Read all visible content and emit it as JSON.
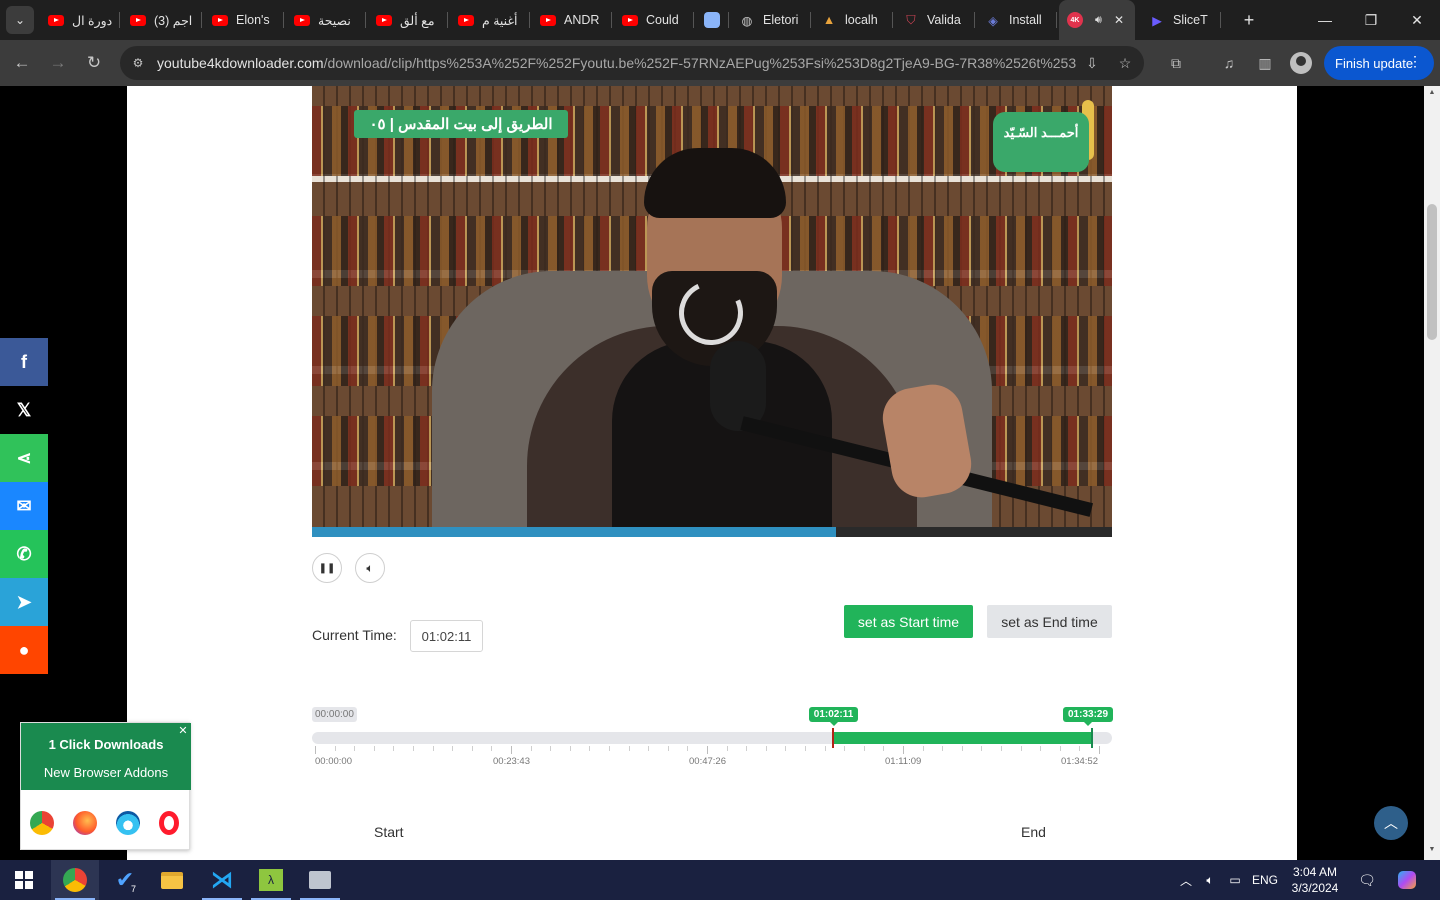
{
  "browser": {
    "tabs": [
      {
        "title": "دورة ال",
        "icon": "youtube-icon"
      },
      {
        "title": "(3) اجم",
        "icon": "youtube-icon"
      },
      {
        "title": "Elon's",
        "icon": "youtube-icon"
      },
      {
        "title": "نصيحة",
        "icon": "youtube-icon"
      },
      {
        "title": "مع ألق",
        "icon": "youtube-icon"
      },
      {
        "title": "أغنية م",
        "icon": "youtube-icon"
      },
      {
        "title": "ANDR",
        "icon": "youtube-icon"
      },
      {
        "title": "Could",
        "icon": "youtube-icon"
      },
      {
        "title": "",
        "icon": "blank-page-icon"
      },
      {
        "title": "Eletori",
        "icon": "globe-icon"
      },
      {
        "title": "localh",
        "icon": "localhost-icon"
      },
      {
        "title": "Valida",
        "icon": "validator-icon"
      },
      {
        "title": "Install",
        "icon": "install-icon"
      },
      {
        "title": "",
        "icon": "4k-downloader-icon"
      },
      {
        "title": "SliceT",
        "icon": "slicetube-icon"
      }
    ],
    "url_main": "youtube4kdownloader.com",
    "url_rest": "/download/clip/https%253A%252F%252Fyoutu.be%252F-57RNzAEPug%253Fsi%253D8g2TjeA9-BG-7R38%2526t%253D...",
    "finish_update": "Finish update"
  },
  "video": {
    "banner_text": "الطريق إلى بيت المقدس | ٠٥",
    "channel_logo_text": "أحمـــد السّـيّد",
    "progress_fraction": 0.655
  },
  "player": {
    "current_time_label": "Current Time:",
    "current_time": "01:02:11",
    "set_start": "set as Start time",
    "set_end": "set as End time"
  },
  "range": {
    "min_tag": "00:00:00",
    "start_tag": "01:02:11",
    "end_tag": "01:33:29",
    "start_fraction": 0.651,
    "end_fraction": 0.975,
    "tick_labels": [
      "00:00:00",
      "00:23:43",
      "00:47:26",
      "01:11:09",
      "01:34:52"
    ]
  },
  "columns": {
    "start": "Start",
    "end": "End"
  },
  "share": [
    {
      "name": "facebook",
      "glyph": "f",
      "color": "#3b5998"
    },
    {
      "name": "x",
      "glyph": "𝕏",
      "color": "#000000"
    },
    {
      "name": "sharethis",
      "glyph": "⋖",
      "color": "#30c25a"
    },
    {
      "name": "messenger",
      "glyph": "✉",
      "color": "#1a87ff"
    },
    {
      "name": "whatsapp",
      "glyph": "✆",
      "color": "#25c35a"
    },
    {
      "name": "telegram",
      "glyph": "➤",
      "color": "#2aa3d8"
    },
    {
      "name": "reddit",
      "glyph": "●",
      "color": "#ff4500"
    }
  ],
  "addon": {
    "title": "1 Click Downloads",
    "subtitle": "New Browser Addons"
  },
  "taskbar": {
    "lang": "ENG",
    "time": "3:04 AM",
    "date": "3/3/2024",
    "badge": "7"
  }
}
